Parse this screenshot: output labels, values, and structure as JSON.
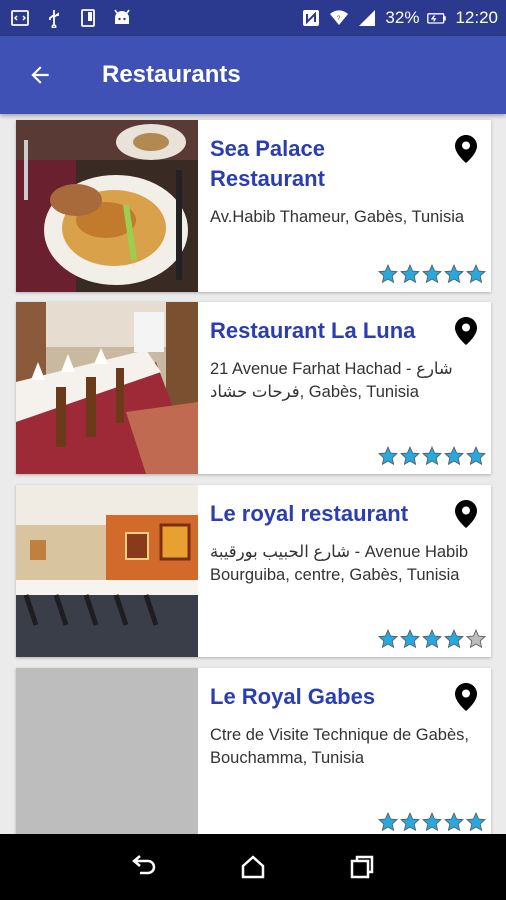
{
  "status_bar": {
    "battery": "32%",
    "time": "12:20",
    "left_icons": [
      "code-icon",
      "usb-icon",
      "device-icon",
      "android-icon"
    ],
    "right_icons": [
      "nfc-icon",
      "wifi-icon",
      "signal-icon",
      "battery-icon"
    ]
  },
  "app_bar": {
    "title": "Restaurants",
    "back_icon": "arrow-back-icon"
  },
  "restaurants": [
    {
      "name": "Sea Palace Restaurant",
      "address": "Av.Habib Thameur, Gabès, Tunisia",
      "rating": 5,
      "image": "food-plate-photo"
    },
    {
      "name": "Restaurant La Luna",
      "address": "21 Avenue Farhat Hachad - شارع فرحات حشاد, Gabès, Tunisia",
      "rating": 5,
      "image": "dining-room-photo"
    },
    {
      "name": "Le royal restaurant",
      "address": "شارع الحبيب بورقيبة - Avenue Habib Bourguiba, centre, Gabès, Tunisia",
      "rating": 4,
      "image": "banquet-hall-photo"
    },
    {
      "name": "Le Royal Gabes",
      "address": "Ctre de Visite Technique de Gabès, Bouchamma, Tunisia",
      "rating": 5,
      "image": "placeholder-gray"
    }
  ],
  "colors": {
    "status_bar": "#2b3a8f",
    "app_bar": "#3f51b5",
    "title_text": "#2b3eb0",
    "star_filled": "#29a8e0",
    "star_empty": "#bdbdbd"
  },
  "nav_bar": {
    "buttons": [
      "back-nav-icon",
      "home-icon",
      "recents-icon"
    ]
  }
}
